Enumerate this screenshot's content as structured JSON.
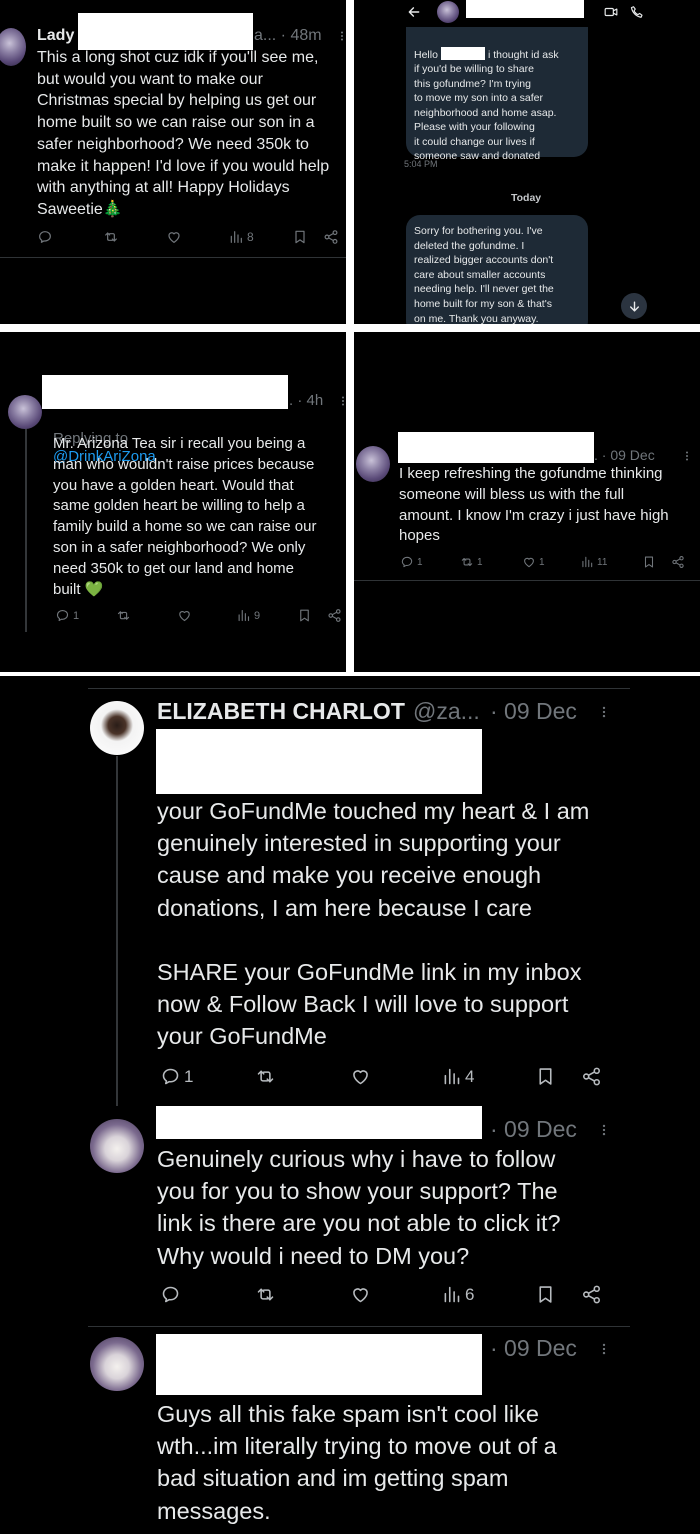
{
  "panel1": {
    "name": "Lady",
    "meta_tail": "a... · 48m",
    "body": "This a long shot cuz idk if you'll see me,\nbut would you want to make our\nChristmas special by helping us get our\nhome built so we can raise our son in a\nsafer neighborhood? We need 350k to\nmake it happen! I'd love if you would help\nwith anything at all! Happy Holidays\nSaweetie🎄",
    "views": "8"
  },
  "panel2": {
    "msg1_part1": "Hello",
    "msg1_part2": "i thought id ask",
    "msg1_rest": "if you'd be willing to share\nthis gofundme? I'm trying\nto move my son into a safer\nneighborhood and home asap.\nPlease with your following\nit could change our lives if\nsomeone saw and donated",
    "time1": "5:04 PM",
    "day": "Today",
    "msg2": "Sorry for bothering you. I've\ndeleted the gofundme. I\nrealized bigger accounts don't\ncare about smaller accounts\nneeding help. I'll never get the\nhome built for my son & that's\non me. Thank you anyway."
  },
  "panel3": {
    "meta_tail": ". · 4h",
    "replying_label": "Replying to",
    "replying_handle": "@DrinkAriZona",
    "body": "Mr. Arizona Tea sir i recall you being a\nman who wouldn't raise prices because\nyou have a golden heart. Would that\nsame golden heart be willing to help a\nfamily build a home so we can raise our\nson in a safer neighborhood? We only\nneed 350k to get our land and home\nbuilt 💚",
    "replies": "1",
    "views": "9"
  },
  "panel4": {
    "meta_tail": ". · 09 Dec",
    "body": "I keep refreshing the gofundme thinking\nsomeone will bless us with the full\namount. I know I'm crazy i just have high\nhopes",
    "replies": "1",
    "retweets": "1",
    "likes": "1",
    "views": "11"
  },
  "panel5": {
    "tweet1": {
      "name": "ELIZABETH CHARLOT",
      "handle": "@za...",
      "time": "· 09 Dec",
      "body": "your GoFundMe touched my heart & I am\ngenuinely interested in supporting your\ncause and make you receive enough\ndonations, I am here because I care\n\nSHARE your GoFundMe link in my inbox\nnow & Follow Back I will love to support\nyour GoFundMe",
      "replies": "1",
      "views": "4"
    },
    "tweet2": {
      "time": "· 09 Dec",
      "body": "Genuinely curious why i have to follow\nyou for you to show your support? The\nlink is there are you not able to click it?\nWhy would i need to DM you?",
      "views": "6"
    },
    "tweet3": {
      "time": "· 09 Dec",
      "body": "Guys all this fake spam isn't cool like\nwth...im literally trying to move out of a\nbad situation and im getting spam\nmessages."
    }
  },
  "icons": [
    "reply-icon",
    "retweet-icon",
    "like-icon",
    "views-icon",
    "bookmark-icon",
    "share-icon",
    "more-icon",
    "back-arrow-icon",
    "video-call-icon",
    "phone-icon",
    "scroll-down-icon"
  ],
  "colors": {
    "background": "#000000",
    "text": "#e7e9ea",
    "muted": "#71767b",
    "link": "#1d9bf0",
    "bubble": "#1e2a36"
  }
}
